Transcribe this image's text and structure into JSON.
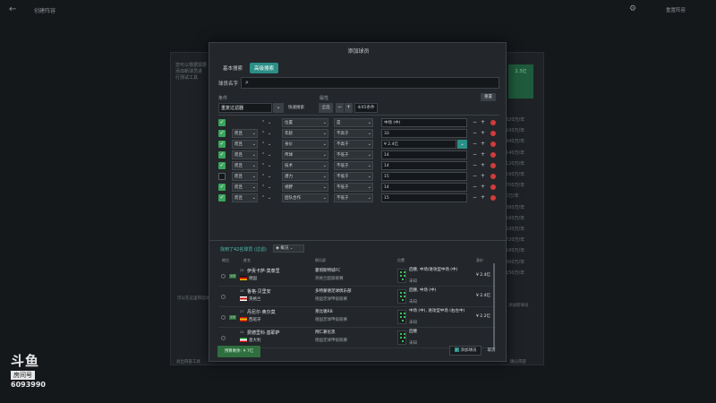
{
  "topbar": {
    "back": "←",
    "title": "创建阵容",
    "right": "重置阵容"
  },
  "background": {
    "left_lines": [
      "您可以根据需要",
      "添加新球员进",
      "行测试工具"
    ],
    "col_values": [
      "320万/年",
      "100万/年",
      "340万/年",
      "140万/年",
      "120万/年",
      "180万/年",
      "700万/年",
      "0万/年",
      "380万/年",
      "160万/年",
      "100万/年",
      "720万/年",
      "180万/年",
      "300万/年",
      "150万/年"
    ],
    "green_label": "2.3亿",
    "bottom_left": "退出阵容工具",
    "bottom_right": "确认阵容",
    "side_left": "可以在这里筛选球员",
    "side_right": "添加新球员"
  },
  "logo": {
    "brand": "斗鱼",
    "room": "房间号",
    "number": "6093990"
  },
  "modal": {
    "title": "添加球员",
    "tabs": [
      "基本搜索",
      "高级搜索"
    ],
    "name_label": "球员名字",
    "name_placeholder": "",
    "cond_label": "条件",
    "prop_label": "属性",
    "reset_label": "重置",
    "filter_value": "重复过滤器",
    "quick_label": "快速搜索",
    "match_label": "全选",
    "minus": "−",
    "plus": "+",
    "count_label": "4/45条件"
  },
  "rows": [
    {
      "checked": true,
      "logic": "",
      "attr": "位置",
      "op": "是",
      "value": "中场 (中)"
    },
    {
      "checked": true,
      "logic": "而且",
      "attr": "年龄",
      "op": "不高于",
      "value": "33"
    },
    {
      "checked": true,
      "logic": "而且",
      "attr": "身价",
      "op": "不高于",
      "value": "¥ 2.4亿",
      "highlight": true
    },
    {
      "checked": true,
      "logic": "而且",
      "attr": "传球",
      "op": "不低于",
      "value": "14"
    },
    {
      "checked": true,
      "logic": "而且",
      "attr": "技术",
      "op": "不低于",
      "value": "14"
    },
    {
      "checked": false,
      "logic": "而且",
      "attr": "潜力",
      "op": "不低于",
      "value": "15"
    },
    {
      "checked": true,
      "logic": "而且",
      "attr": "视野",
      "op": "不低于",
      "value": "14"
    },
    {
      "checked": true,
      "logic": "而且",
      "attr": "团队合作",
      "op": "不低于",
      "value": "15"
    }
  ],
  "results": {
    "found": "找到了42名球员 (过滤)",
    "view": "概况",
    "headers": {
      "status": "地位",
      "name": "姓名",
      "club": "俱乐部",
      "position": "位置",
      "value": "身价"
    }
  },
  "players": [
    {
      "badge": "交易",
      "age": "25",
      "name": "伊贡卡萨·莫泰里",
      "nation": "德国",
      "club": "曼彻斯特城FC",
      "league": "英格兰超级联赛",
      "position": "后腰, 中场/进攻型中场 (中)",
      "position2": "未知",
      "price": "¥ 2.4亿",
      "flag": [
        "#111",
        "#c11",
        "#e8c300"
      ]
    },
    {
      "badge": "",
      "age": "26",
      "name": "鲁格·贝里安",
      "nation": "英格兰",
      "club": "多特蒙德足球俱乐部",
      "league": "德国足球甲级联赛",
      "position": "后腰, 中场 (中)",
      "position2": "未知",
      "price": "¥ 2.4亿",
      "flag": [
        "#fff",
        "#c11",
        "#fff"
      ]
    },
    {
      "badge": "交易",
      "age": "27",
      "name": "丹尼尔·奥尔莫",
      "nation": "西班牙",
      "club": "莱比锡RB",
      "league": "德国足球甲级联赛",
      "position": "中场 (中), 进攻型中场 (右左中)",
      "position2": "未知",
      "price": "¥ 2.2亿",
      "flag": [
        "#c11",
        "#e8c300",
        "#c11"
      ]
    },
    {
      "badge": "",
      "age": "24",
      "name": "费德里科·基耶萨",
      "nation": "意大利",
      "club": "拜仁慕尼黑",
      "league": "德国足球甲级联赛",
      "position": "后腰",
      "position2": "未知",
      "price": "",
      "flag": [
        "#1a8f3a",
        "#fff",
        "#c11"
      ]
    }
  ],
  "footer": {
    "budget": "预算剩余: ¥ 7亿",
    "add": "添加球员",
    "cancel": "取消"
  },
  "colors": {
    "accent": "#2b8f86",
    "check": "#3aa55c",
    "delete": "#d23b3b",
    "link": "#4ec2b6"
  }
}
